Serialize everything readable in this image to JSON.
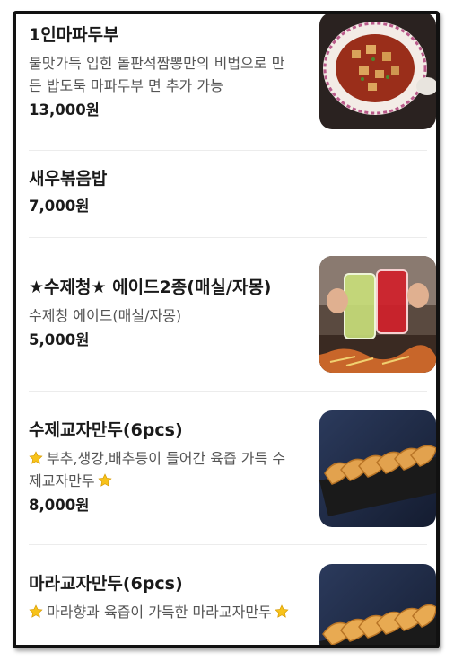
{
  "menu": {
    "items": [
      {
        "name": "1인마파두부",
        "desc": "불맛가득 입힌 돌판석짬뽕만의 비법으로 만든 밥도둑 마파두부 면 추가 가능",
        "price": "13,000원",
        "image": "mapo-tofu"
      },
      {
        "name": "새우볶음밥",
        "price": "7,000원"
      },
      {
        "name": "★수제청★ 에이드2종(매실/자몽)",
        "desc": "수제청 에이드(매실/자몽)",
        "price": "5,000원",
        "image": "ade-drinks"
      },
      {
        "name": "수제교자만두(6pcs)",
        "desc": "부추,생강,배추등이 들어간 육즙 가득 수제교자만두",
        "desc_icon": "star-emoji-icon",
        "price": "8,000원",
        "image": "gyoza"
      },
      {
        "name": "마라교자만두(6pcs)",
        "desc": "마라향과 육즙이 가득한 마라교자만두",
        "desc_icon": "star-emoji-icon",
        "image": "mala-gyoza"
      }
    ]
  }
}
